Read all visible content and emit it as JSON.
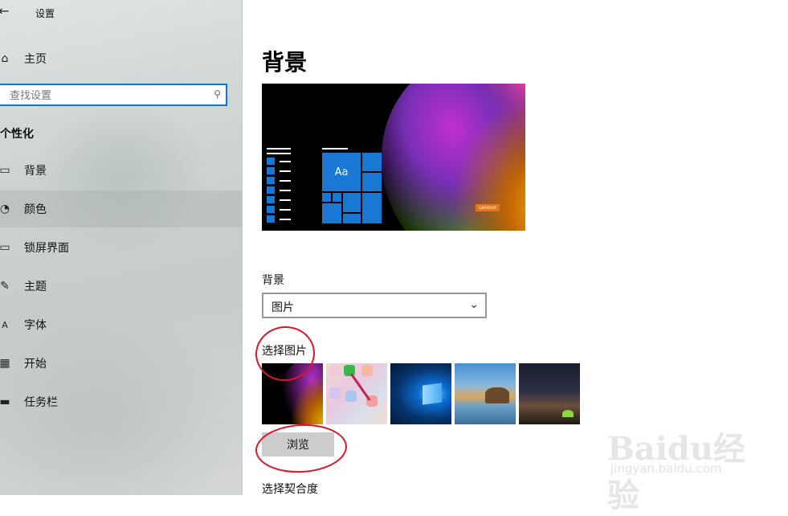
{
  "window": {
    "title": "设置",
    "back_icon": "back-arrow-icon"
  },
  "sidebar": {
    "home_label": "主页",
    "search_placeholder": "查找设置",
    "section_heading": "个性化",
    "items": [
      {
        "label": "背景",
        "icon": "picture-icon"
      },
      {
        "label": "颜色",
        "icon": "palette-icon"
      },
      {
        "label": "锁屏界面",
        "icon": "lock-screen-icon"
      },
      {
        "label": "主题",
        "icon": "theme-brush-icon"
      },
      {
        "label": "字体",
        "icon": "font-icon"
      },
      {
        "label": "开始",
        "icon": "start-icon"
      },
      {
        "label": "任务栏",
        "icon": "taskbar-icon"
      }
    ],
    "active_index": 1
  },
  "main": {
    "title": "背景",
    "preview": {
      "tile_text": "Aa",
      "logo_text": "Lenovo"
    },
    "background_label": "背景",
    "background_value": "图片",
    "choose_picture_label": "选择图片",
    "browse_label": "浏览",
    "choose_fit_label": "选择契合度"
  },
  "watermark": {
    "brand": "Baidu经验",
    "url": "jingyan.baidu.com"
  },
  "colors": {
    "accent": "#0a78d4",
    "annotation": "#e0142a"
  }
}
